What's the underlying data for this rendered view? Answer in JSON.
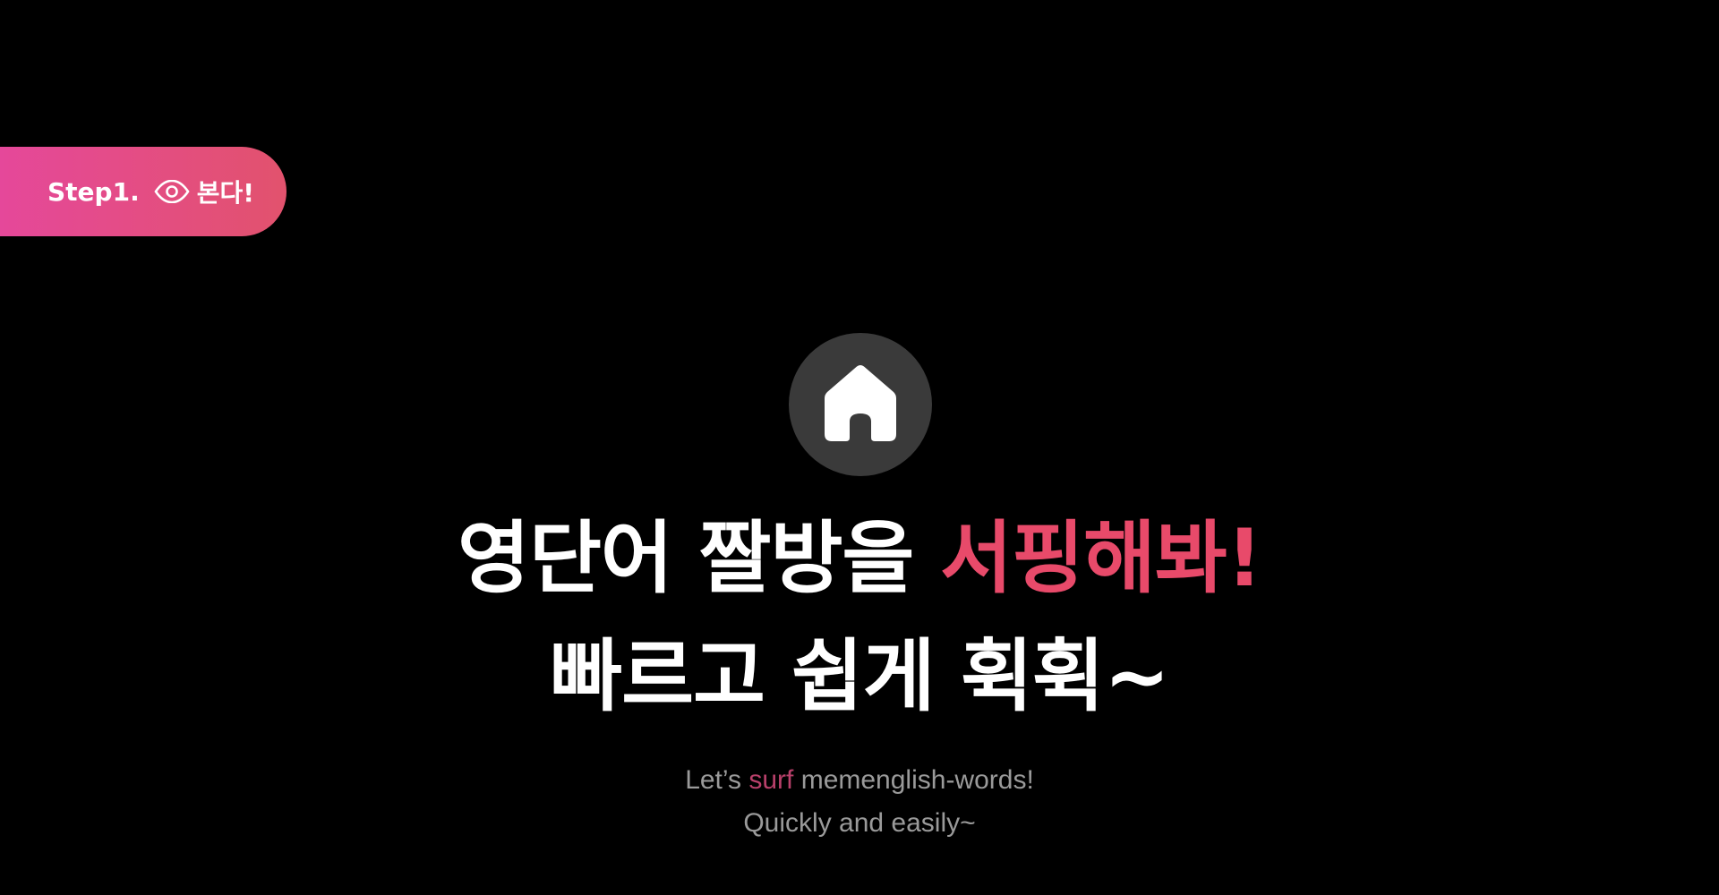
{
  "step": {
    "label": "Step1.",
    "action": "본다!",
    "icon": "eye-icon"
  },
  "hero": {
    "icon": "home-icon",
    "headline_line1_white": "영단어 짤방을 ",
    "headline_line1_accent": "서핑해봐!",
    "headline_line2": "빠르고 쉽게 휙휙~"
  },
  "subtext": {
    "line1_pre": "Let’s ",
    "line1_accent": "surf",
    "line1_post": " memenglish-words!",
    "line2": "Quickly and easily~"
  },
  "colors": {
    "background": "#000000",
    "accent": "#e84a6a",
    "pill_gradient_start": "#e5489a",
    "pill_gradient_end": "#e2526d",
    "icon_circle": "#3a3a3a",
    "subtext": "#9a9a9a"
  }
}
